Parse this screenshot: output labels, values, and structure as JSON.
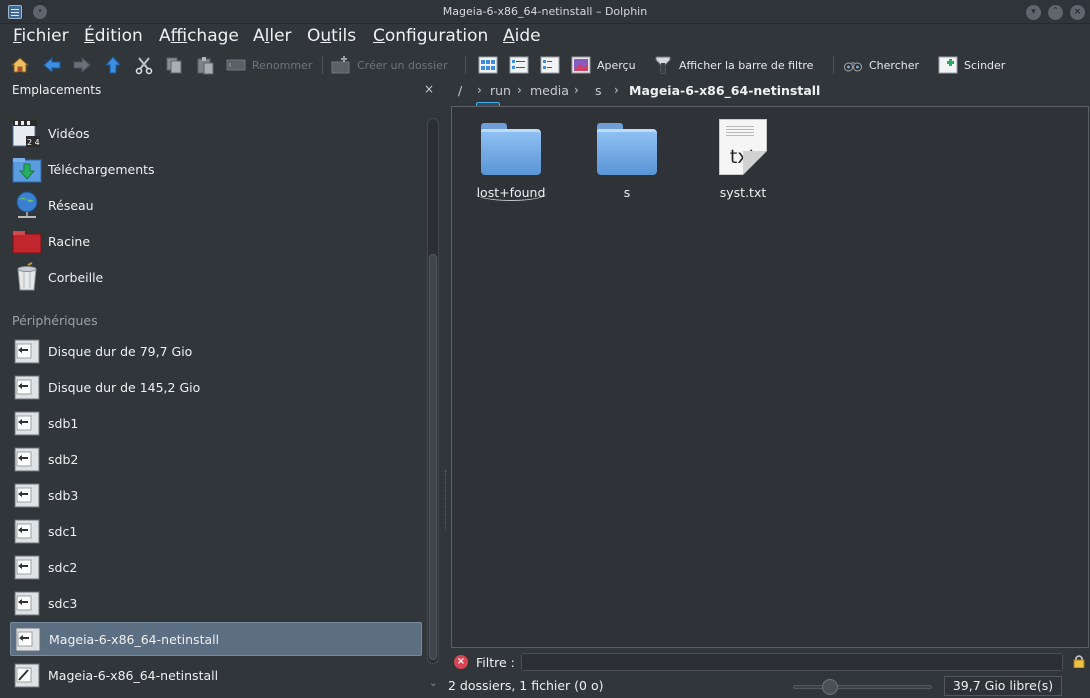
{
  "window": {
    "title": "Mageia-6-x86_64-netinstall – Dolphin"
  },
  "menu": [
    {
      "pre": "",
      "u": "F",
      "post": "ichier"
    },
    {
      "pre": "",
      "u": "É",
      "post": "dition"
    },
    {
      "pre": "A",
      "u": "f",
      "post": "fichage"
    },
    {
      "pre": "A",
      "u": "l",
      "post": "ler"
    },
    {
      "pre": "O",
      "u": "u",
      "post": "tils"
    },
    {
      "pre": "",
      "u": "C",
      "post": "onfiguration"
    },
    {
      "pre": "",
      "u": "A",
      "post": "ide"
    }
  ],
  "toolbar": {
    "rename": "Renommer",
    "new_folder": "Créer un dossier",
    "preview": "Aperçu",
    "filter_bar": "Afficher la barre de filtre",
    "search": "Chercher",
    "split": "Scinder"
  },
  "places": {
    "title": "Emplacements",
    "close": "×",
    "items": [
      {
        "label": "Vidéos",
        "icon": "videos-icon"
      },
      {
        "label": "Téléchargements",
        "icon": "downloads-icon"
      },
      {
        "label": "Réseau",
        "icon": "network-icon"
      },
      {
        "label": "Racine",
        "icon": "root-folder-icon"
      },
      {
        "label": "Corbeille",
        "icon": "trash-icon"
      }
    ],
    "devices_title": "Périphériques",
    "devices": [
      {
        "label": "Disque dur de 79,7 Gio"
      },
      {
        "label": "Disque dur de 145,2 Gio"
      },
      {
        "label": "sdb1"
      },
      {
        "label": "sdb2"
      },
      {
        "label": "sdb3"
      },
      {
        "label": "sdc1"
      },
      {
        "label": "sdc2"
      },
      {
        "label": "sdc3"
      },
      {
        "label": "Mageia-6-x86_64-netinstall",
        "selected": true
      },
      {
        "label": "Mageia-6-x86_64-netinstall"
      }
    ]
  },
  "breadcrumb": [
    "/",
    "run",
    "media",
    "s",
    "Mageia-6-x86_64-netinstall"
  ],
  "files": [
    {
      "name": "lost+found",
      "type": "folder"
    },
    {
      "name": "s",
      "type": "folder"
    },
    {
      "name": "syst.txt",
      "type": "text",
      "badge": "txt"
    }
  ],
  "filter": {
    "label": "Filtre :",
    "value": ""
  },
  "status": {
    "summary": "2 dossiers, 1 fichier (0 o)",
    "free_space": "39,7 Gio libre(s)"
  }
}
